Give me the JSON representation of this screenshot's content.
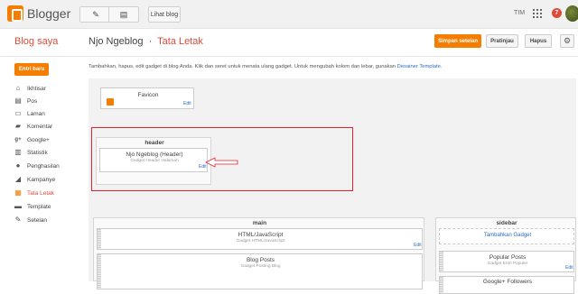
{
  "topbar": {
    "logo_text": "Blogger",
    "pencil_icon": "pencil-icon",
    "pages_icon": "pages-icon",
    "view_blog_label": "Lihat blog",
    "user_name": "TIM",
    "notification_count": "7"
  },
  "header": {
    "blog_saya": "Blog saya",
    "blog_name": "Njo Ngeblog",
    "separator": "·",
    "page_name": "Tata Letak",
    "save_label": "Simpan setelan",
    "preview_label": "Pratinjau",
    "delete_label": "Hapus"
  },
  "sidebar": {
    "new_post_label": "Entri baru",
    "items": [
      {
        "label": "Ikhtisar",
        "icon": "home-icon"
      },
      {
        "label": "Pos",
        "icon": "posts-icon"
      },
      {
        "label": "Laman",
        "icon": "pages-icon"
      },
      {
        "label": "Komentar",
        "icon": "comment-icon"
      },
      {
        "label": "Google+",
        "icon": "gplus-icon"
      },
      {
        "label": "Statistik",
        "icon": "stats-icon"
      },
      {
        "label": "Penghasilan",
        "icon": "earnings-icon"
      },
      {
        "label": "Kampanye",
        "icon": "campaign-icon"
      },
      {
        "label": "Tata Letak",
        "icon": "layout-icon"
      },
      {
        "label": "Template",
        "icon": "template-icon"
      },
      {
        "label": "Setelan",
        "icon": "wrench-icon"
      }
    ],
    "active_item": "Tata Letak"
  },
  "main": {
    "description": "Tambahkan, hapus, edit gadget di blog Anda. Klik dan seret untuk menata ulang gadget. Untuk mengubah kolom dan lebar, gunakan",
    "designer_link": "Desainer Template",
    "description_end": ".",
    "favicon": {
      "title": "Favicon",
      "edit": "Edit"
    },
    "header_section": {
      "label": "header",
      "gadget_title": "Njo Ngeblog (Header)",
      "gadget_sub": "Gadget Header Halaman",
      "edit": "Edit"
    },
    "main_section": {
      "label": "main",
      "gadgets": [
        {
          "title": "HTML/JavaScript",
          "sub": "Gadget HTML/JavaScript",
          "edit": "Edit"
        },
        {
          "title": "Blog Posts",
          "sub": "Gadget Posting Blog",
          "edit": ""
        }
      ]
    },
    "sidebar_section": {
      "label": "sidebar",
      "add_gadget": "Tambahkan Gadget",
      "gadgets": [
        {
          "title": "Popular Posts",
          "sub": "Gadget Entri Populer",
          "edit": "Edit"
        },
        {
          "title": "Google+ Followers",
          "sub": "",
          "edit": ""
        }
      ]
    }
  },
  "colors": {
    "accent_orange": "#f57d00",
    "accent_red": "#dd4b39",
    "highlight_frame": "#e2202e",
    "link_blue": "#2a6cc2"
  }
}
